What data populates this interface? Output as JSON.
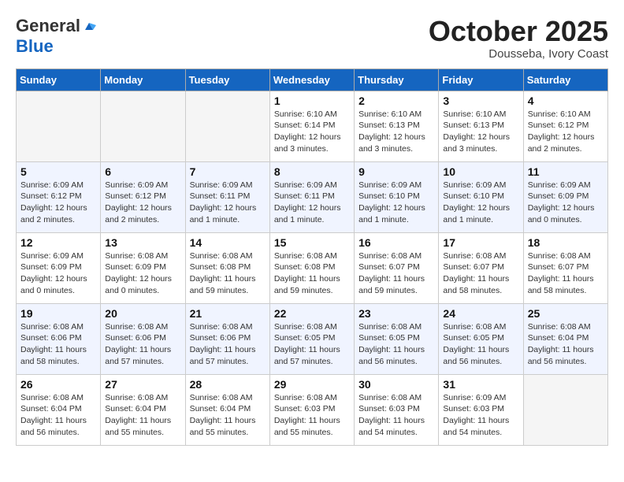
{
  "header": {
    "logo_general": "General",
    "logo_blue": "Blue",
    "month": "October 2025",
    "location": "Dousseba, Ivory Coast"
  },
  "weekdays": [
    "Sunday",
    "Monday",
    "Tuesday",
    "Wednesday",
    "Thursday",
    "Friday",
    "Saturday"
  ],
  "weeks": [
    [
      {
        "day": "",
        "info": ""
      },
      {
        "day": "",
        "info": ""
      },
      {
        "day": "",
        "info": ""
      },
      {
        "day": "1",
        "info": "Sunrise: 6:10 AM\nSunset: 6:14 PM\nDaylight: 12 hours\nand 3 minutes."
      },
      {
        "day": "2",
        "info": "Sunrise: 6:10 AM\nSunset: 6:13 PM\nDaylight: 12 hours\nand 3 minutes."
      },
      {
        "day": "3",
        "info": "Sunrise: 6:10 AM\nSunset: 6:13 PM\nDaylight: 12 hours\nand 3 minutes."
      },
      {
        "day": "4",
        "info": "Sunrise: 6:10 AM\nSunset: 6:12 PM\nDaylight: 12 hours\nand 2 minutes."
      }
    ],
    [
      {
        "day": "5",
        "info": "Sunrise: 6:09 AM\nSunset: 6:12 PM\nDaylight: 12 hours\nand 2 minutes."
      },
      {
        "day": "6",
        "info": "Sunrise: 6:09 AM\nSunset: 6:12 PM\nDaylight: 12 hours\nand 2 minutes."
      },
      {
        "day": "7",
        "info": "Sunrise: 6:09 AM\nSunset: 6:11 PM\nDaylight: 12 hours\nand 1 minute."
      },
      {
        "day": "8",
        "info": "Sunrise: 6:09 AM\nSunset: 6:11 PM\nDaylight: 12 hours\nand 1 minute."
      },
      {
        "day": "9",
        "info": "Sunrise: 6:09 AM\nSunset: 6:10 PM\nDaylight: 12 hours\nand 1 minute."
      },
      {
        "day": "10",
        "info": "Sunrise: 6:09 AM\nSunset: 6:10 PM\nDaylight: 12 hours\nand 1 minute."
      },
      {
        "day": "11",
        "info": "Sunrise: 6:09 AM\nSunset: 6:09 PM\nDaylight: 12 hours\nand 0 minutes."
      }
    ],
    [
      {
        "day": "12",
        "info": "Sunrise: 6:09 AM\nSunset: 6:09 PM\nDaylight: 12 hours\nand 0 minutes."
      },
      {
        "day": "13",
        "info": "Sunrise: 6:08 AM\nSunset: 6:09 PM\nDaylight: 12 hours\nand 0 minutes."
      },
      {
        "day": "14",
        "info": "Sunrise: 6:08 AM\nSunset: 6:08 PM\nDaylight: 11 hours\nand 59 minutes."
      },
      {
        "day": "15",
        "info": "Sunrise: 6:08 AM\nSunset: 6:08 PM\nDaylight: 11 hours\nand 59 minutes."
      },
      {
        "day": "16",
        "info": "Sunrise: 6:08 AM\nSunset: 6:07 PM\nDaylight: 11 hours\nand 59 minutes."
      },
      {
        "day": "17",
        "info": "Sunrise: 6:08 AM\nSunset: 6:07 PM\nDaylight: 11 hours\nand 58 minutes."
      },
      {
        "day": "18",
        "info": "Sunrise: 6:08 AM\nSunset: 6:07 PM\nDaylight: 11 hours\nand 58 minutes."
      }
    ],
    [
      {
        "day": "19",
        "info": "Sunrise: 6:08 AM\nSunset: 6:06 PM\nDaylight: 11 hours\nand 58 minutes."
      },
      {
        "day": "20",
        "info": "Sunrise: 6:08 AM\nSunset: 6:06 PM\nDaylight: 11 hours\nand 57 minutes."
      },
      {
        "day": "21",
        "info": "Sunrise: 6:08 AM\nSunset: 6:06 PM\nDaylight: 11 hours\nand 57 minutes."
      },
      {
        "day": "22",
        "info": "Sunrise: 6:08 AM\nSunset: 6:05 PM\nDaylight: 11 hours\nand 57 minutes."
      },
      {
        "day": "23",
        "info": "Sunrise: 6:08 AM\nSunset: 6:05 PM\nDaylight: 11 hours\nand 56 minutes."
      },
      {
        "day": "24",
        "info": "Sunrise: 6:08 AM\nSunset: 6:05 PM\nDaylight: 11 hours\nand 56 minutes."
      },
      {
        "day": "25",
        "info": "Sunrise: 6:08 AM\nSunset: 6:04 PM\nDaylight: 11 hours\nand 56 minutes."
      }
    ],
    [
      {
        "day": "26",
        "info": "Sunrise: 6:08 AM\nSunset: 6:04 PM\nDaylight: 11 hours\nand 56 minutes."
      },
      {
        "day": "27",
        "info": "Sunrise: 6:08 AM\nSunset: 6:04 PM\nDaylight: 11 hours\nand 55 minutes."
      },
      {
        "day": "28",
        "info": "Sunrise: 6:08 AM\nSunset: 6:04 PM\nDaylight: 11 hours\nand 55 minutes."
      },
      {
        "day": "29",
        "info": "Sunrise: 6:08 AM\nSunset: 6:03 PM\nDaylight: 11 hours\nand 55 minutes."
      },
      {
        "day": "30",
        "info": "Sunrise: 6:08 AM\nSunset: 6:03 PM\nDaylight: 11 hours\nand 54 minutes."
      },
      {
        "day": "31",
        "info": "Sunrise: 6:09 AM\nSunset: 6:03 PM\nDaylight: 11 hours\nand 54 minutes."
      },
      {
        "day": "",
        "info": ""
      }
    ]
  ]
}
